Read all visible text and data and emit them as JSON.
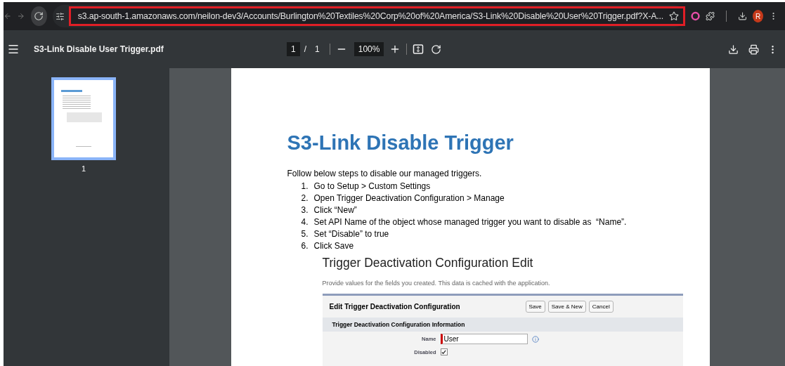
{
  "browser": {
    "url": "s3.ap-south-1.amazonaws.com/neilon-dev3/Accounts/Burlington%20Textiles%20Corp%20of%20America/S3-Link%20Disable%20User%20Trigger.pdf?X-A...",
    "avatar": "R"
  },
  "viewer": {
    "file_name": "S3-Link Disable User Trigger.pdf",
    "page_current": "1",
    "page_separator": "/",
    "page_total": "1",
    "zoom": "100%"
  },
  "thumbnails": [
    {
      "page": "1",
      "selected": true
    }
  ],
  "document": {
    "title": "S3-Link Disable Trigger",
    "intro": "Follow below steps to disable our managed triggers.",
    "steps": [
      {
        "number": "1.",
        "text": "Go to Setup > Custom Settings"
      },
      {
        "number": "2.",
        "text": "Open Trigger Deactivation Configuration > Manage"
      },
      {
        "number": "3.",
        "text": "Click “New”"
      },
      {
        "number": "4.",
        "text": "Set API Name of the object whose managed trigger you want to disable as  “Name”."
      },
      {
        "number": "5.",
        "text": "Set “Disable” to true"
      },
      {
        "number": "6.",
        "text": "Click Save"
      }
    ],
    "screenshot": {
      "title": "Trigger Deactivation Configuration Edit",
      "description": "Provide values for the fields you created. This data is cached with the application.",
      "panel_title": "Edit Trigger Deactivation Configuration",
      "buttons": [
        "Save",
        "Save & New",
        "Cancel"
      ],
      "section_title": "Trigger Deactivation Configuration Information",
      "fields": [
        {
          "kind": "text",
          "label": "Name",
          "value": "User",
          "required": true
        },
        {
          "kind": "checkbox",
          "label": "Disabled",
          "checked": true
        }
      ]
    }
  }
}
